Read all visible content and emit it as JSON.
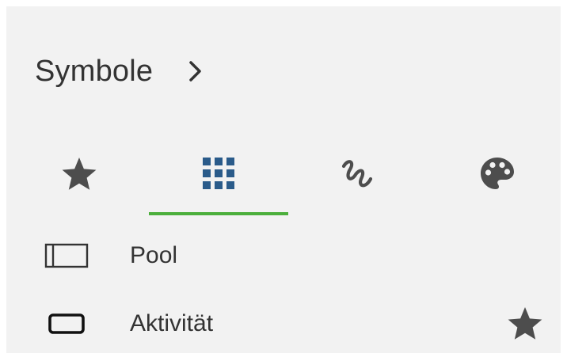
{
  "panel": {
    "title": "Symbole"
  },
  "tabs": [
    {
      "id": "favorites",
      "icon": "star-icon",
      "selected": false
    },
    {
      "id": "shapes",
      "icon": "grid-icon",
      "selected": true
    },
    {
      "id": "freehand",
      "icon": "freehand-icon",
      "selected": false
    },
    {
      "id": "colors",
      "icon": "palette-icon",
      "selected": false
    }
  ],
  "symbols": [
    {
      "label": "Pool",
      "icon": "pool-shape-icon"
    },
    {
      "label": "Aktivität",
      "icon": "activity-shape-icon",
      "favorite_icon": "star-icon"
    }
  ],
  "colors": {
    "panel_bg": "#f2f2f2",
    "text": "#333333",
    "icon_gray": "#4d4d4d",
    "grid_icon_blue": "#2a5b8a",
    "tab_indicator": "#4caf3c"
  }
}
